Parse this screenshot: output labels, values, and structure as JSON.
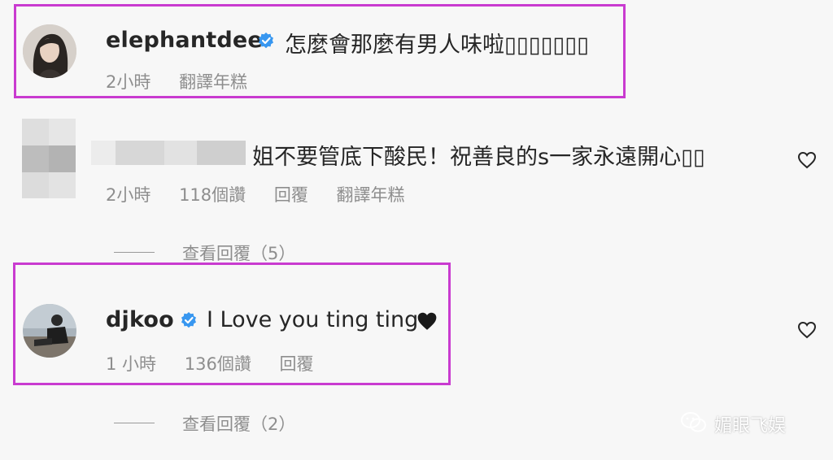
{
  "comments": [
    {
      "username": "elephantdee",
      "text": "怎麼會那麼有男人味啦▯▯▯▯▯▯▯",
      "meta": {
        "time": "2小時",
        "translate": "翻譯年糕"
      }
    },
    {
      "text": "姐不要管底下酸民！祝善良的s一家永遠開心▯▯",
      "meta": {
        "time": "2小時",
        "likes": "118個讚",
        "reply": "回覆",
        "translate": "翻譯年糕"
      },
      "view_replies": "查看回覆（5）"
    },
    {
      "username": "djkoo",
      "text": "I Love you ting ting",
      "meta": {
        "time": "1 小時",
        "likes": "136個讚",
        "reply": "回覆"
      },
      "view_replies": "查看回覆（2）"
    }
  ],
  "watermark": {
    "text": "媚眼飞娱"
  },
  "colors": {
    "highlight": "#c93bd0",
    "verified": "#3897f0",
    "meta": "#8e8e8e"
  },
  "icons": [
    "verified-badge-icon",
    "heart-outline-icon",
    "black-heart-icon",
    "wechat-icon"
  ]
}
